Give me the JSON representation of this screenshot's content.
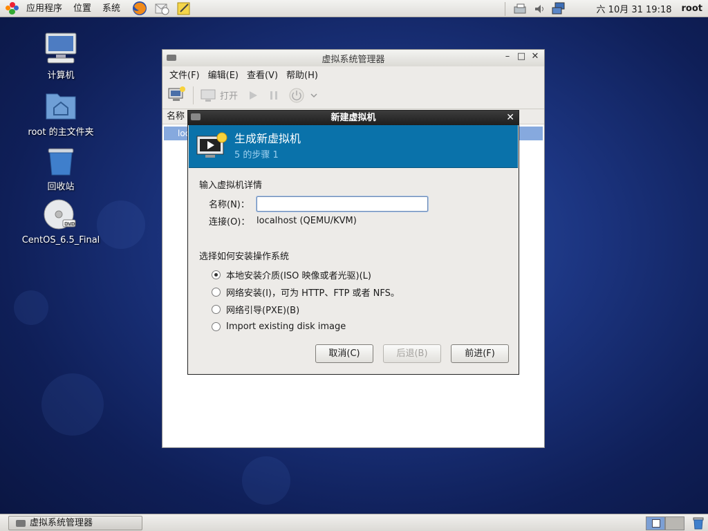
{
  "top_panel": {
    "menus": [
      "应用程序",
      "位置",
      "系统"
    ],
    "clock": "六 10月 31 19:18",
    "user": "root"
  },
  "desktop": {
    "icons": [
      {
        "label": "计算机"
      },
      {
        "label": "root 的主文件夹"
      },
      {
        "label": "回收站"
      },
      {
        "label": "CentOS_6.5_Final"
      }
    ]
  },
  "vmm": {
    "title": "虚拟系统管理器",
    "menu": [
      "文件(F)",
      "编辑(E)",
      "查看(V)",
      "帮助(H)"
    ],
    "toolbar_open": "打开",
    "column_name": "名称",
    "row_text": "loc"
  },
  "dialog": {
    "title": "新建虚拟机",
    "heading": "生成新虚拟机",
    "step": "5 的步骤 1",
    "section1": "输入虚拟机详情",
    "name_label": "名称(N)：",
    "name_value": "",
    "conn_label": "连接(O)：",
    "conn_value": "localhost (QEMU/KVM)",
    "section2": "选择如何安装操作系统",
    "options": [
      {
        "label": "本地安装介质(ISO 映像或者光驱)(L)",
        "selected": true
      },
      {
        "label": "网络安装(I)，可为 HTTP、FTP 或者 NFS。",
        "selected": false
      },
      {
        "label": "网络引导(PXE)(B)",
        "selected": false
      },
      {
        "label": "Import existing disk image",
        "selected": false
      }
    ],
    "buttons": {
      "cancel": "取消(C)",
      "back": "后退(B)",
      "forward": "前进(F)"
    }
  },
  "taskbar": {
    "task_label": "虚拟系统管理器"
  },
  "colors": {
    "banner": "#0a72aa",
    "selection": "#86a9de"
  }
}
